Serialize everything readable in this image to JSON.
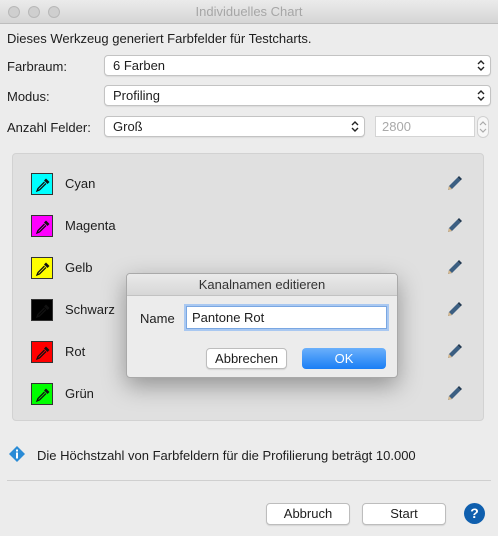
{
  "window": {
    "title": "Individuelles Chart"
  },
  "intro": "Dieses Werkzeug generiert Farbfelder für Testcharts.",
  "fields": {
    "farbraum": {
      "label": "Farbraum:",
      "value": "6 Farben"
    },
    "modus": {
      "label": "Modus:",
      "value": "Profiling"
    },
    "anzahl": {
      "label": "Anzahl Felder:",
      "value": "Groß",
      "number": "2800"
    }
  },
  "channels": [
    {
      "name": "Cyan",
      "color": "#00ffff"
    },
    {
      "name": "Magenta",
      "color": "#ff00ff"
    },
    {
      "name": "Gelb",
      "color": "#ffff00"
    },
    {
      "name": "Schwarz",
      "color": "#000000"
    },
    {
      "name": "Rot",
      "color": "#ff0000"
    },
    {
      "name": "Grün",
      "color": "#00ff00"
    }
  ],
  "info": "Die Höchstzahl von Farbfeldern für die Profilierung beträgt 10.000",
  "buttons": {
    "abbruch": "Abbruch",
    "start": "Start",
    "help": "?"
  },
  "dialog": {
    "title": "Kanalnamen editieren",
    "name_label": "Name",
    "name_value": "Pantone Rot",
    "cancel": "Abbrechen",
    "ok": "OK"
  }
}
